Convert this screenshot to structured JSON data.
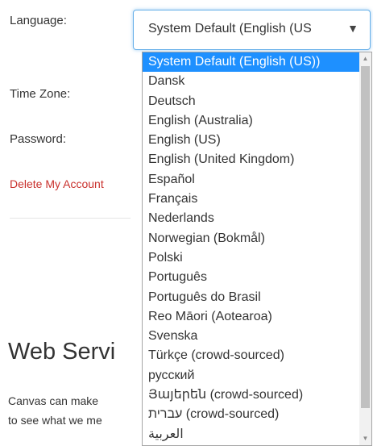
{
  "form": {
    "language_label": "Language:",
    "timezone_label": "Time Zone:",
    "password_label": "Password:",
    "delete_account_link": "Delete My Account"
  },
  "language_select": {
    "value": "System Default (English (US",
    "arrow": "▼"
  },
  "language_dropdown": {
    "options": [
      "System Default (English (US))",
      "Dansk",
      "Deutsch",
      "English (Australia)",
      "English (US)",
      "English (United Kingdom)",
      "Español",
      "Français",
      "Nederlands",
      "Norwegian (Bokmål)",
      "Polski",
      "Português",
      "Português do Brasil",
      "Reo Māori (Aotearoa)",
      "Svenska",
      "Türkçe (crowd-sourced)",
      "русский",
      "Յայերեն (crowd-sourced)",
      "עברית (crowd-sourced)",
      "العربية"
    ],
    "selected_index": 0,
    "scroll_up_glyph": "▲",
    "scroll_down_glyph": "▼"
  },
  "web_services": {
    "title": "Web Servi",
    "line1": "Canvas can make",
    "line2": "to see what we me"
  }
}
